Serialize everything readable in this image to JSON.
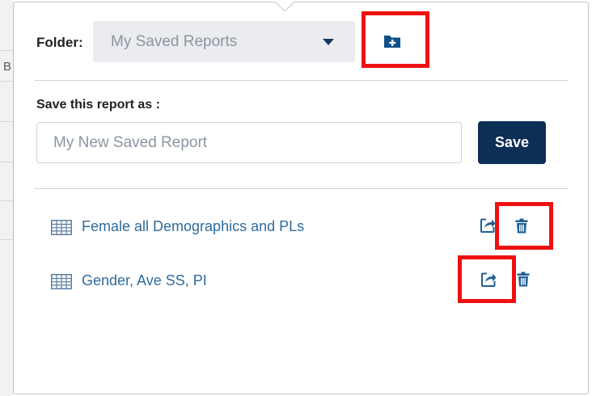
{
  "folder": {
    "label": "Folder:",
    "selected": "My Saved Reports"
  },
  "save_form": {
    "label": "Save this report as :",
    "placeholder": "My New Saved Report",
    "button_label": "Save"
  },
  "background": {
    "partial_letter": "B"
  },
  "reports": [
    {
      "name": "Female all Demographics and PLs"
    },
    {
      "name": "Gender, Ave SS, PI"
    }
  ],
  "colors": {
    "primary": "#0d2e55",
    "link": "#2f6b9e",
    "highlight": "#ee1111",
    "select_bg": "#eaecef"
  },
  "icons": {
    "new_folder": "folder-plus-icon",
    "report": "table-grid-icon",
    "open": "external-link-icon",
    "delete": "trash-icon",
    "dropdown": "caret-down-icon"
  }
}
